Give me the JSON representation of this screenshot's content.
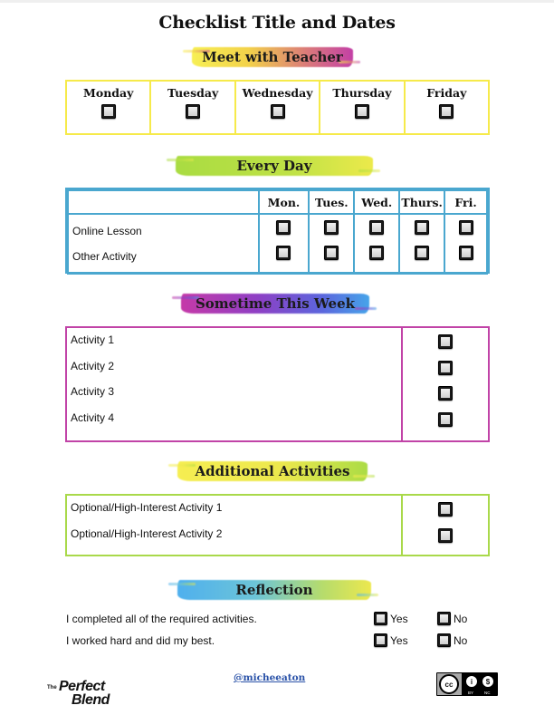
{
  "title": "Checklist Title and Dates",
  "sections": {
    "meet_with_teacher": {
      "heading": "Meet with Teacher",
      "colors": {
        "border": "#f6ea4a"
      },
      "days": [
        {
          "label": "Monday",
          "checked": false
        },
        {
          "label": "Tuesday",
          "checked": false
        },
        {
          "label": "Wednesday",
          "checked": false
        },
        {
          "label": "Thursday",
          "checked": false
        },
        {
          "label": "Friday",
          "checked": false
        }
      ]
    },
    "every_day": {
      "heading": "Every Day",
      "colors": {
        "border": "#4aa7cf"
      },
      "columns": [
        "",
        "Mon.",
        "Tues.",
        "Wed.",
        "Thurs.",
        "Fri."
      ],
      "rows": [
        {
          "label": "Online Lesson",
          "checks": [
            false,
            false,
            false,
            false,
            false
          ]
        },
        {
          "label": "Other Activity",
          "checks": [
            false,
            false,
            false,
            false,
            false
          ]
        }
      ]
    },
    "sometime_this_week": {
      "heading": "Sometime This Week",
      "colors": {
        "border": "#c143a7"
      },
      "items": [
        {
          "label": "Activity 1",
          "checked": false
        },
        {
          "label": "Activity 2",
          "checked": false
        },
        {
          "label": "Activity 3",
          "checked": false
        },
        {
          "label": "Activity 4",
          "checked": false
        }
      ]
    },
    "additional_activities": {
      "heading": "Additional Activities",
      "colors": {
        "border": "#a9d94a"
      },
      "items": [
        {
          "label": "Optional/High-Interest Activity 1",
          "checked": false
        },
        {
          "label": "Optional/High-Interest Activity 2",
          "checked": false
        }
      ]
    },
    "reflection": {
      "heading": "Reflection",
      "questions": [
        {
          "label": "I completed all of the required activities.",
          "yes_label": "Yes",
          "no_label": "No"
        },
        {
          "label": "I worked hard and did my best.",
          "yes_label": "Yes",
          "no_label": "No"
        }
      ]
    }
  },
  "footer": {
    "logo": {
      "the": "The",
      "line1": "Perfect",
      "line2": "Blend"
    },
    "handle": "@micheeaton",
    "license": {
      "cc": "cc",
      "by_icon": "i",
      "nc_icon": "$",
      "by_text": "BY",
      "nc_text": "NC"
    }
  }
}
